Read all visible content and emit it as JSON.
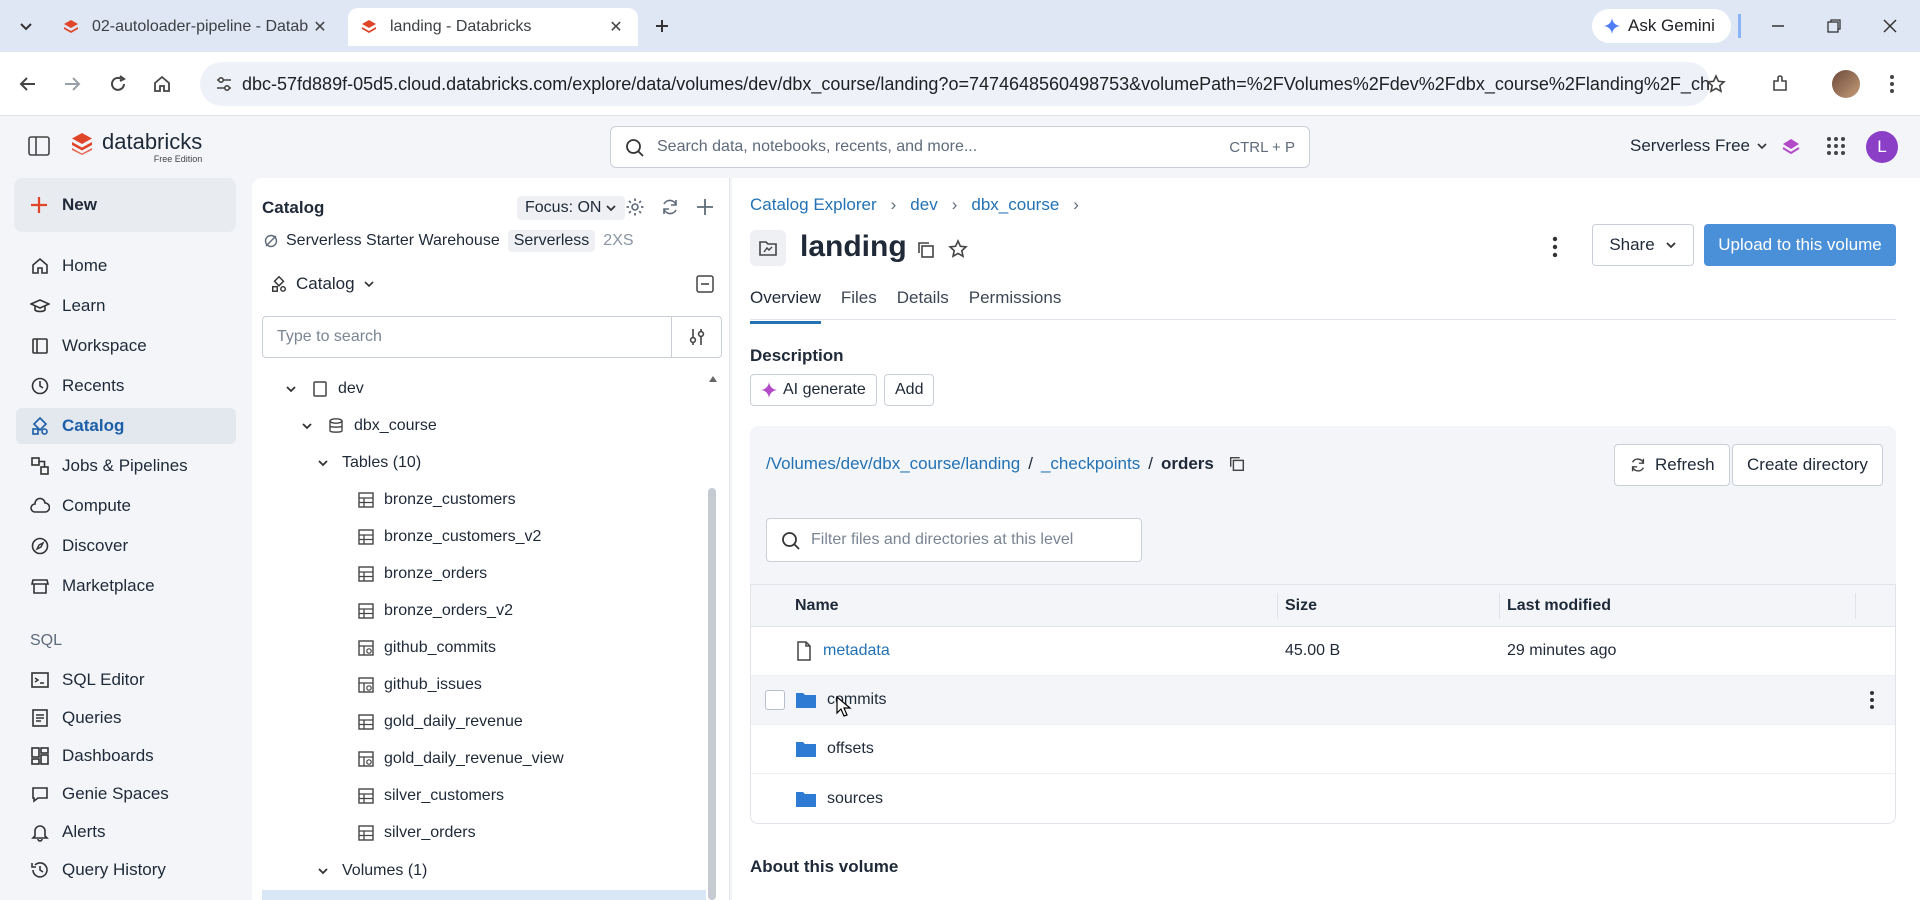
{
  "browser": {
    "tabs": [
      {
        "title": "02-autoloader-pipeline - Datab",
        "active": false
      },
      {
        "title": "landing - Databricks",
        "active": true
      }
    ],
    "ask_gemini": "Ask Gemini",
    "url": "dbc-57fd889f-05d5.cloud.databricks.com/explore/data/volumes/dev/dbx_course/landing?o=7474648560498753&volumePath=%2FVolumes%2Fdev%2Fdbx_course%2Flanding%2F_check..."
  },
  "appbar": {
    "logo_text": "databricks",
    "logo_sub": "Free Edition",
    "search_placeholder": "Search data, notebooks, recents, and more...",
    "search_shortcut": "CTRL + P",
    "workspace": "Serverless Free",
    "user_initial": "L"
  },
  "leftnav": {
    "new_label": "New",
    "items": [
      {
        "label": "Home",
        "icon": "home-icon"
      },
      {
        "label": "Learn",
        "icon": "learn-icon"
      },
      {
        "label": "Workspace",
        "icon": "workspace-icon"
      },
      {
        "label": "Recents",
        "icon": "clock-icon"
      },
      {
        "label": "Catalog",
        "icon": "catalog-icon",
        "active": true
      },
      {
        "label": "Jobs & Pipelines",
        "icon": "jobs-icon"
      },
      {
        "label": "Compute",
        "icon": "cloud-icon"
      },
      {
        "label": "Discover",
        "icon": "compass-icon"
      },
      {
        "label": "Marketplace",
        "icon": "store-icon"
      }
    ],
    "sql_section": "SQL",
    "sql_items": [
      {
        "label": "SQL Editor",
        "icon": "sql-editor-icon"
      },
      {
        "label": "Queries",
        "icon": "queries-icon"
      },
      {
        "label": "Dashboards",
        "icon": "dashboard-icon"
      },
      {
        "label": "Genie Spaces",
        "icon": "genie-icon"
      },
      {
        "label": "Alerts",
        "icon": "bell-icon"
      },
      {
        "label": "Query History",
        "icon": "history-icon"
      }
    ]
  },
  "catalog_panel": {
    "title": "Catalog",
    "focus": "Focus: ON",
    "warehouse": "Serverless Starter Warehouse",
    "warehouse_badge": "Serverless",
    "warehouse_size": "2XS",
    "catalog_select": "Catalog",
    "search_placeholder": "Type to search",
    "tree": {
      "catalog": "dev",
      "schema": "dbx_course",
      "tables_group": "Tables (10)",
      "tables": [
        {
          "name": "bronze_customers",
          "kind": "table"
        },
        {
          "name": "bronze_customers_v2",
          "kind": "table"
        },
        {
          "name": "bronze_orders",
          "kind": "table"
        },
        {
          "name": "bronze_orders_v2",
          "kind": "table"
        },
        {
          "name": "github_commits",
          "kind": "view"
        },
        {
          "name": "github_issues",
          "kind": "view"
        },
        {
          "name": "gold_daily_revenue",
          "kind": "table"
        },
        {
          "name": "gold_daily_revenue_view",
          "kind": "view"
        },
        {
          "name": "silver_customers",
          "kind": "table"
        },
        {
          "name": "silver_orders",
          "kind": "table"
        }
      ],
      "volumes_group": "Volumes (1)"
    }
  },
  "main": {
    "breadcrumbs": [
      "Catalog Explorer",
      "dev",
      "dbx_course"
    ],
    "title": "landing",
    "share_label": "Share",
    "upload_label": "Upload to this volume",
    "tabs": [
      "Overview",
      "Files",
      "Details",
      "Permissions"
    ],
    "description_label": "Description",
    "ai_generate": "AI generate",
    "add_label": "Add",
    "path": {
      "root": "/Volumes/dev/dbx_course/landing",
      "mid": "_checkpoints",
      "current": "orders",
      "sep": "/"
    },
    "refresh_label": "Refresh",
    "create_dir_label": "Create directory",
    "filter_placeholder": "Filter files and directories at this level",
    "columns": {
      "name": "Name",
      "size": "Size",
      "modified": "Last modified"
    },
    "rows": [
      {
        "name": "metadata",
        "type": "file",
        "size": "45.00 B",
        "modified": "29 minutes ago"
      },
      {
        "name": "commits",
        "type": "folder",
        "size": "",
        "modified": ""
      },
      {
        "name": "offsets",
        "type": "folder",
        "size": "",
        "modified": ""
      },
      {
        "name": "sources",
        "type": "folder",
        "size": "",
        "modified": ""
      }
    ],
    "about_label": "About this volume"
  }
}
